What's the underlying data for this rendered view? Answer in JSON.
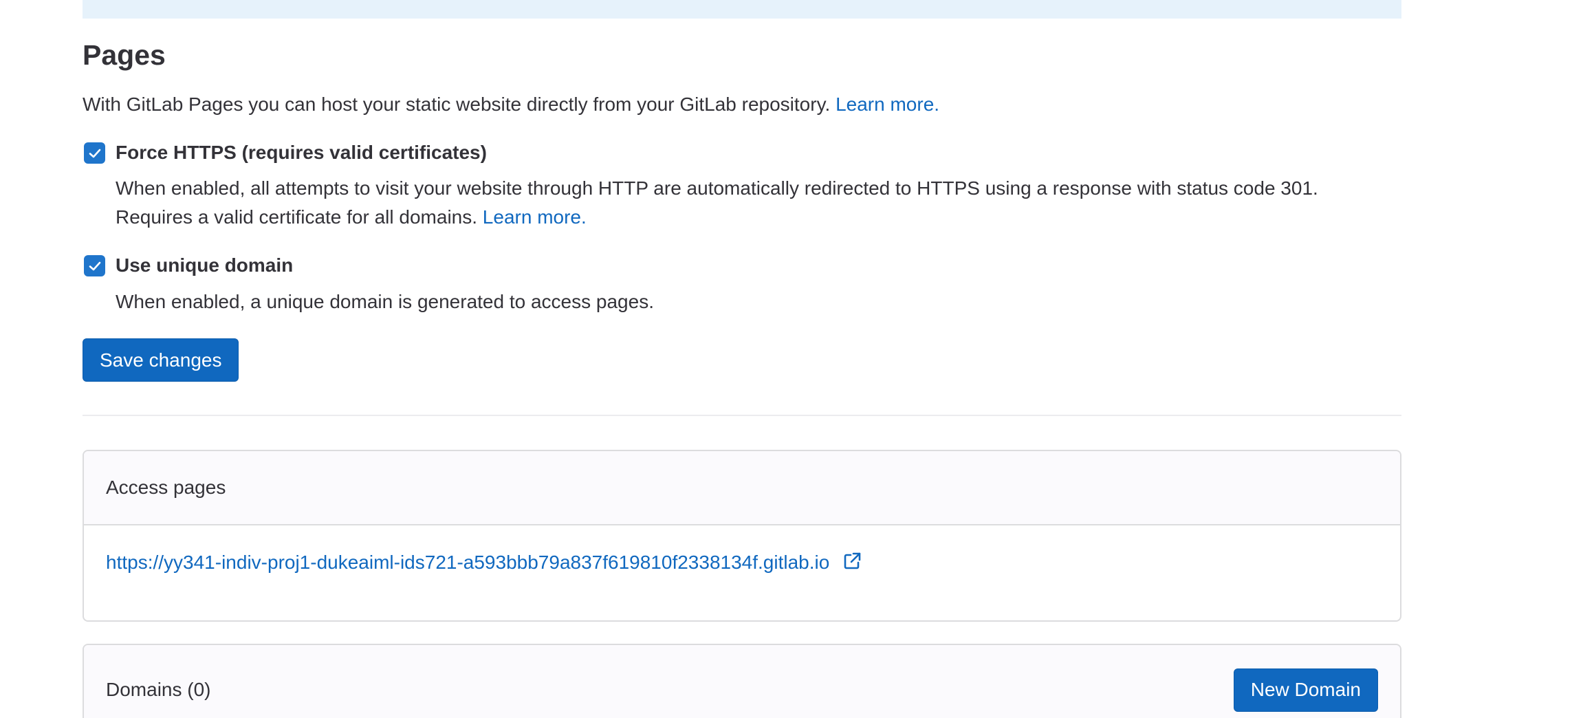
{
  "pages": {
    "title": "Pages",
    "intro_text": "With GitLab Pages you can host your static website directly from your GitLab repository.",
    "intro_link": "Learn more.",
    "force_https": {
      "checked": true,
      "label": "Force HTTPS (requires valid certificates)",
      "help_line1": "When enabled, all attempts to visit your website through HTTP are automatically redirected to HTTPS using a response with status code 301.",
      "help_line2": "Requires a valid certificate for all domains.",
      "help_link": "Learn more."
    },
    "unique_domain": {
      "checked": true,
      "label": "Use unique domain",
      "help": "When enabled, a unique domain is generated to access pages."
    },
    "save_label": "Save changes"
  },
  "access_pages": {
    "header": "Access pages",
    "url": "https://yy341-indiv-proj1-dukeaiml-ids721-a593bbb79a837f619810f2338134f.gitlab.io",
    "icon": "external-link-icon"
  },
  "domains": {
    "header": "Domains (0)",
    "new_domain_label": "New Domain"
  },
  "colors": {
    "accent": "#1068bf",
    "checkbox": "#1f75cb",
    "banner": "#e6f2fb",
    "text": "#333238",
    "border": "#dcdcde"
  }
}
